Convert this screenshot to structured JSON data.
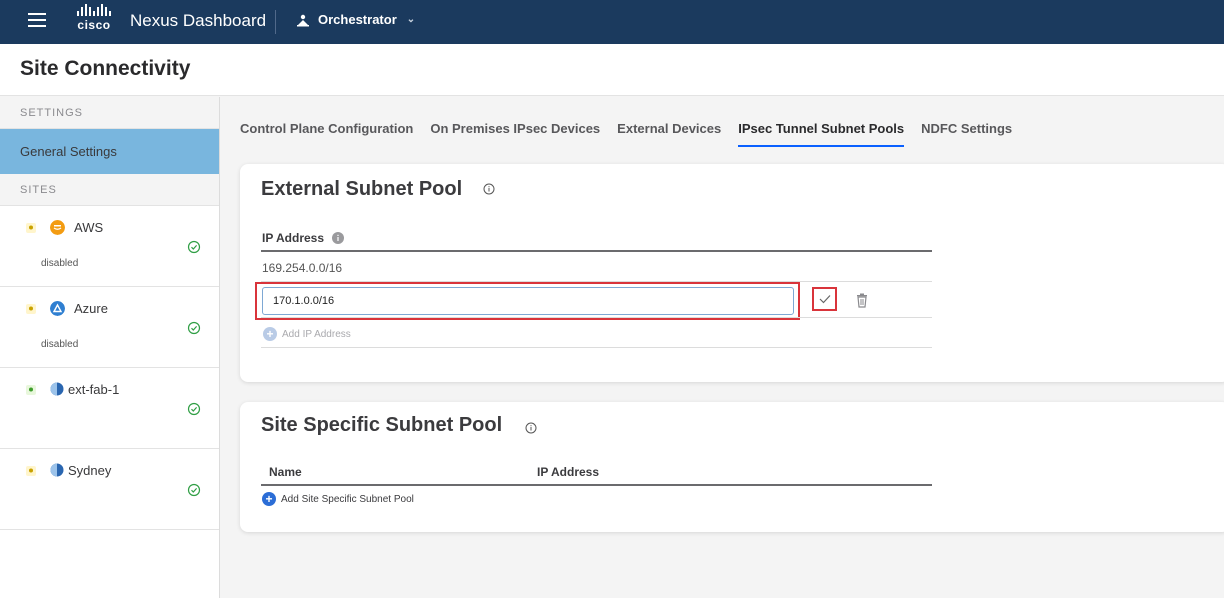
{
  "topbar": {
    "logo_text": "cisco",
    "app_title": "Nexus Dashboard",
    "service": "Orchestrator",
    "colors": {
      "bar": "#1b3a5e"
    }
  },
  "page": {
    "title": "Site Connectivity"
  },
  "sidebar": {
    "settings_header": "SETTINGS",
    "active_item": "General Settings",
    "sites_header": "SITES",
    "sites": [
      {
        "name": "AWS",
        "status": "disabled",
        "logo_color": "#f39c12",
        "health": "ok"
      },
      {
        "name": "Azure",
        "status": "disabled",
        "logo_color": "#2f7fd1",
        "health": "ok"
      },
      {
        "name": "ext-fab-1",
        "status": "",
        "logo_color": "#2a66b0",
        "health": "ok"
      },
      {
        "name": "Sydney",
        "status": "",
        "logo_color": "#2a66b0",
        "health": "ok"
      }
    ]
  },
  "tabs": [
    {
      "label": "Control Plane Configuration",
      "active": false
    },
    {
      "label": "On Premises IPsec Devices",
      "active": false
    },
    {
      "label": "External Devices",
      "active": false
    },
    {
      "label": "IPsec Tunnel Subnet Pools",
      "active": true
    },
    {
      "label": "NDFC Settings",
      "active": false
    }
  ],
  "external_pool": {
    "title": "External Subnet Pool",
    "column": "IP Address",
    "existing": "169.254.0.0/16",
    "input_value": "170.1.0.0/16",
    "add_label": "Add IP Address"
  },
  "site_pool": {
    "title": "Site Specific Subnet Pool",
    "col_name": "Name",
    "col_ip": "IP Address",
    "add_label": "Add Site Specific Subnet Pool"
  }
}
